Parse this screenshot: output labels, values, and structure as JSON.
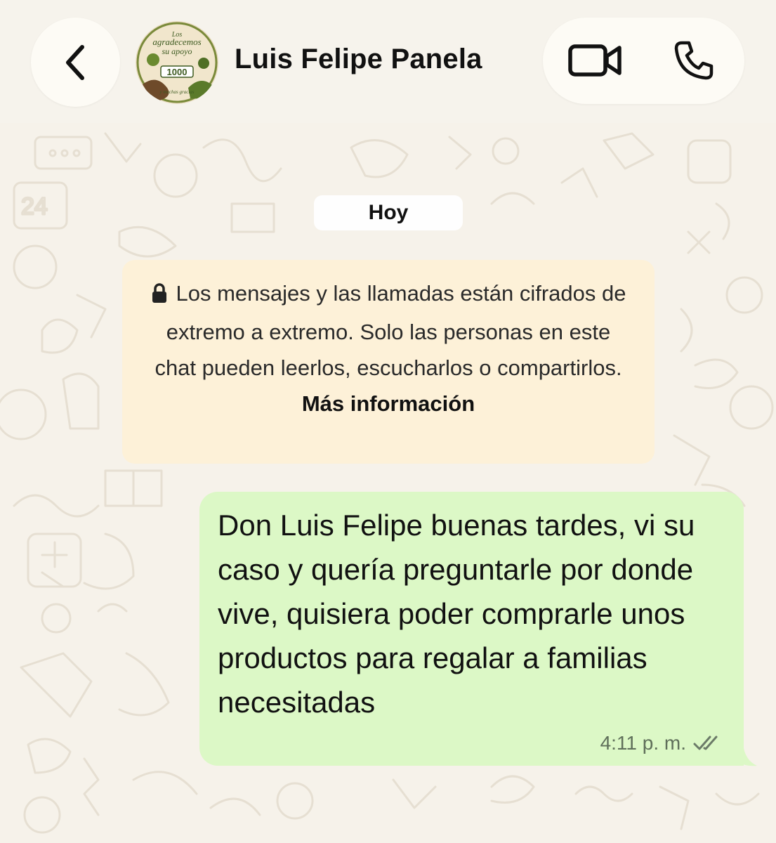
{
  "header": {
    "back_icon": "chevron-left-icon",
    "avatar": {
      "lines": [
        "Los",
        "agradecemos",
        "su apoyo",
        "1000",
        "y muchas gracias"
      ]
    },
    "contact_name": "Luis Felipe Panela",
    "video_icon": "video-camera-icon",
    "phone_icon": "phone-icon"
  },
  "chat": {
    "date_label": "Hoy",
    "encryption_notice": {
      "icon": "lock-icon",
      "text": "Los mensajes y las llamadas están cifrados de extremo a extremo. Solo las personas en este chat pueden leerlos, escucharlos o compartirlos.",
      "link_label": "Más información"
    },
    "messages": [
      {
        "direction": "outgoing",
        "text": "Don Luis Felipe buenas tardes, vi su caso y quería preguntarle por donde vive, quisiera poder comprarle unos productos para regalar a familias necesitadas",
        "time": "4:11 p. m.",
        "status_icon": "double-check-icon"
      }
    ]
  },
  "colors": {
    "wallpaper": "#f6f2ea",
    "outgoing_bubble": "#dcf8c6",
    "encryption_banner": "#fdf1d8",
    "date_chip": "#fefefe"
  }
}
